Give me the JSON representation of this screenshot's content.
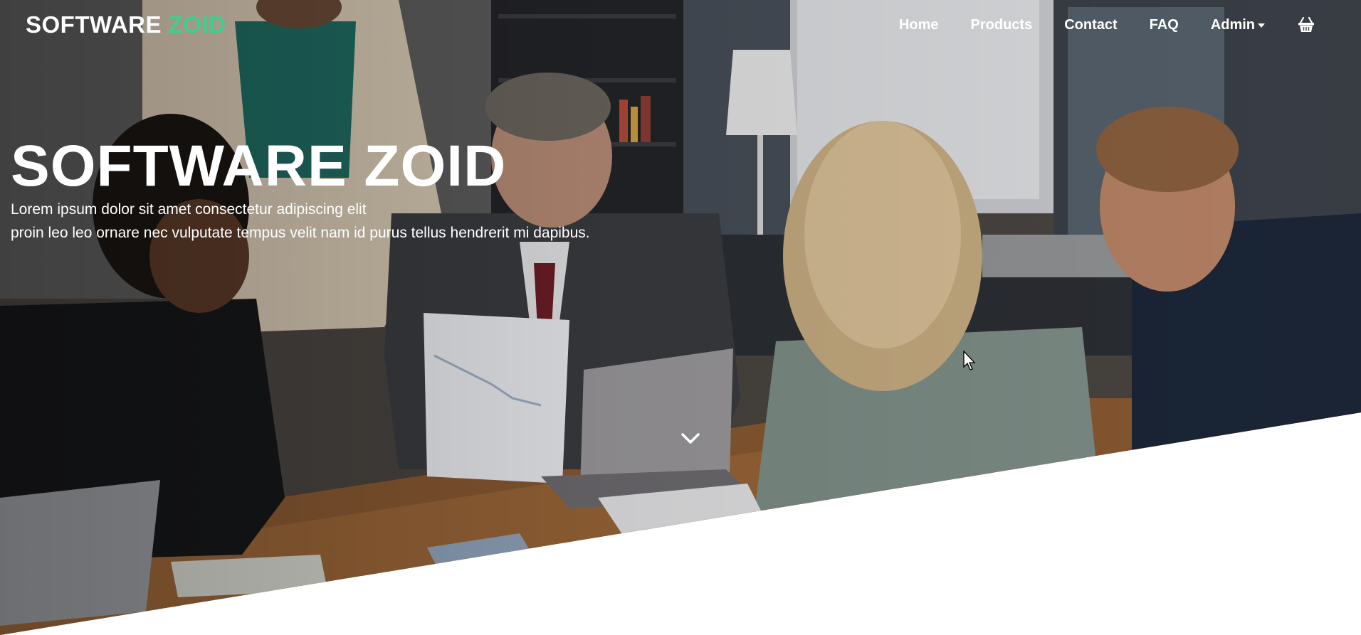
{
  "navbar": {
    "brand_part1": "SOFTWARE",
    "brand_part2": "ZOID",
    "links": [
      {
        "label": "Home"
      },
      {
        "label": "Products"
      },
      {
        "label": "Contact"
      },
      {
        "label": "FAQ"
      }
    ],
    "admin_label": "Admin",
    "cart_icon": "shopping-basket-icon"
  },
  "hero": {
    "title": "SOFTWARE ZOID",
    "subtitle_line1": "Lorem ipsum dolor sit amet consectetur adipiscing elit",
    "subtitle_line2": "proin leo leo ornare nec vulputate tempus velit nam id purus tellus hendrerit mi dapibus.",
    "scroll_icon": "chevron-down-icon",
    "image": "office-meeting-photo"
  },
  "colors": {
    "accent": "#3ecf8e",
    "nav_text": "#ffffff",
    "background": "#ffffff"
  }
}
